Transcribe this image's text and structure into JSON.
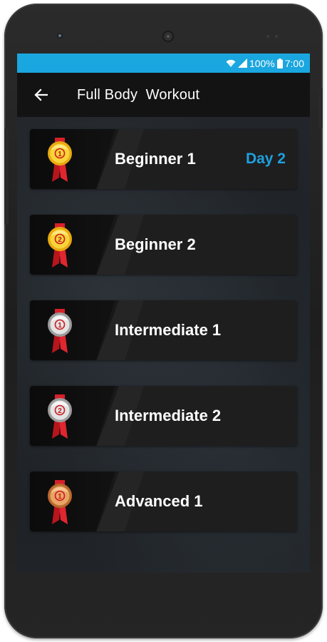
{
  "status_bar": {
    "battery": "100%",
    "time": "7:00"
  },
  "toolbar": {
    "title": "Full Body  Workout"
  },
  "levels": [
    {
      "name": "Beginner 1",
      "medal": "gold",
      "number": "1",
      "badge": "Day 2"
    },
    {
      "name": "Beginner 2",
      "medal": "gold",
      "number": "2",
      "badge": ""
    },
    {
      "name": "Intermediate 1",
      "medal": "silver",
      "number": "1",
      "badge": ""
    },
    {
      "name": "Intermediate 2",
      "medal": "silver",
      "number": "2",
      "badge": ""
    },
    {
      "name": "Advanced 1",
      "medal": "bronze",
      "number": "1",
      "badge": ""
    }
  ],
  "colors": {
    "status_bar": "#1aa6df",
    "accent": "#1ea0de",
    "gold": "#f3c21a",
    "silver": "#d7d7d7",
    "bronze": "#e09a55",
    "ribbon": "#d8202a"
  },
  "icons": {
    "back": "arrow-left-icon",
    "wifi": "wifi-icon",
    "signal": "signal-icon",
    "battery": "battery-icon"
  }
}
